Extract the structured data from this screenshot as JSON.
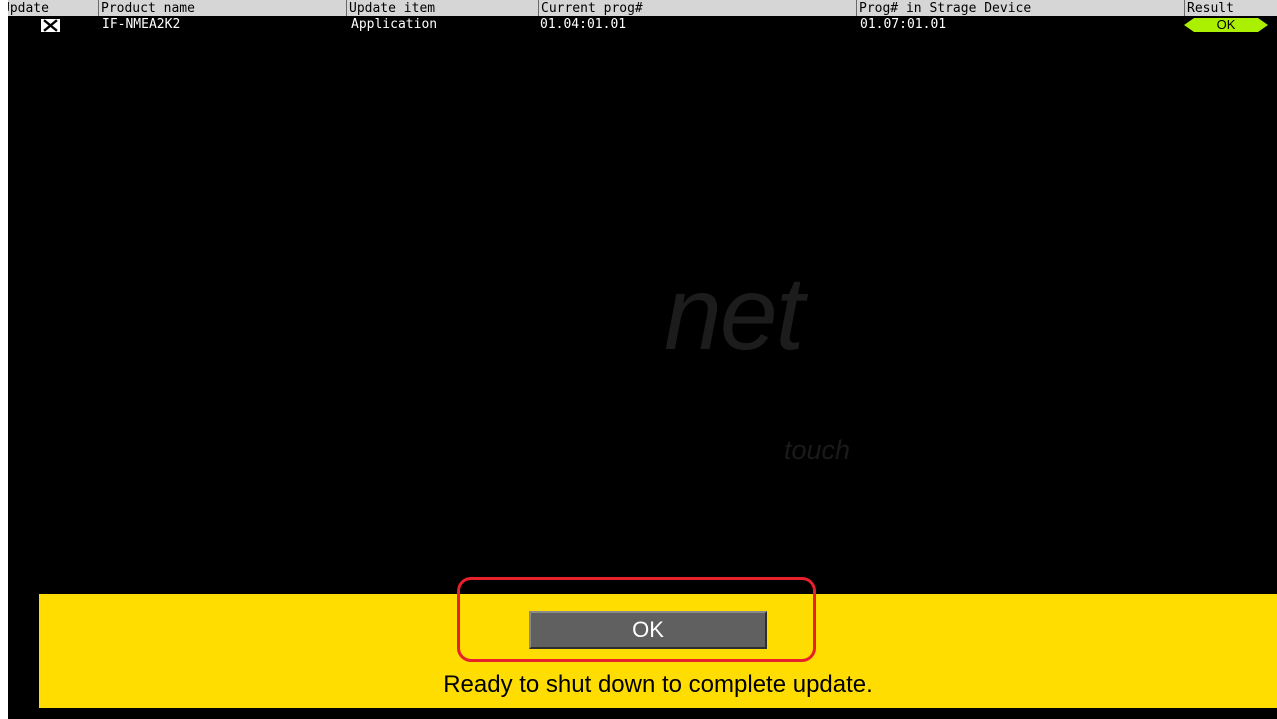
{
  "table": {
    "headers": {
      "update": "Update",
      "product_name": "Product name",
      "update_item": "Update item",
      "current_prog": "Current prog#",
      "prog_in_storage": "Prog# in Strage Device",
      "result": "Result"
    },
    "rows": [
      {
        "update_checked": true,
        "product_name": "IF-NMEA2K2",
        "update_item": "Application",
        "current_prog": "01.04:01.01",
        "prog_in_storage": "01.07:01.01",
        "result": "OK"
      }
    ]
  },
  "watermark": {
    "big": "net",
    "small": "touch"
  },
  "dialog": {
    "ok_label": "OK",
    "message": "Ready to shut down to complete update."
  },
  "colors": {
    "screen_bg": "#000000",
    "header_bg": "#d6d6d6",
    "dialog_bg": "#ffdd00",
    "button_bg": "#606060",
    "result_ok": "#aaf000",
    "highlight": "#e8202a"
  }
}
